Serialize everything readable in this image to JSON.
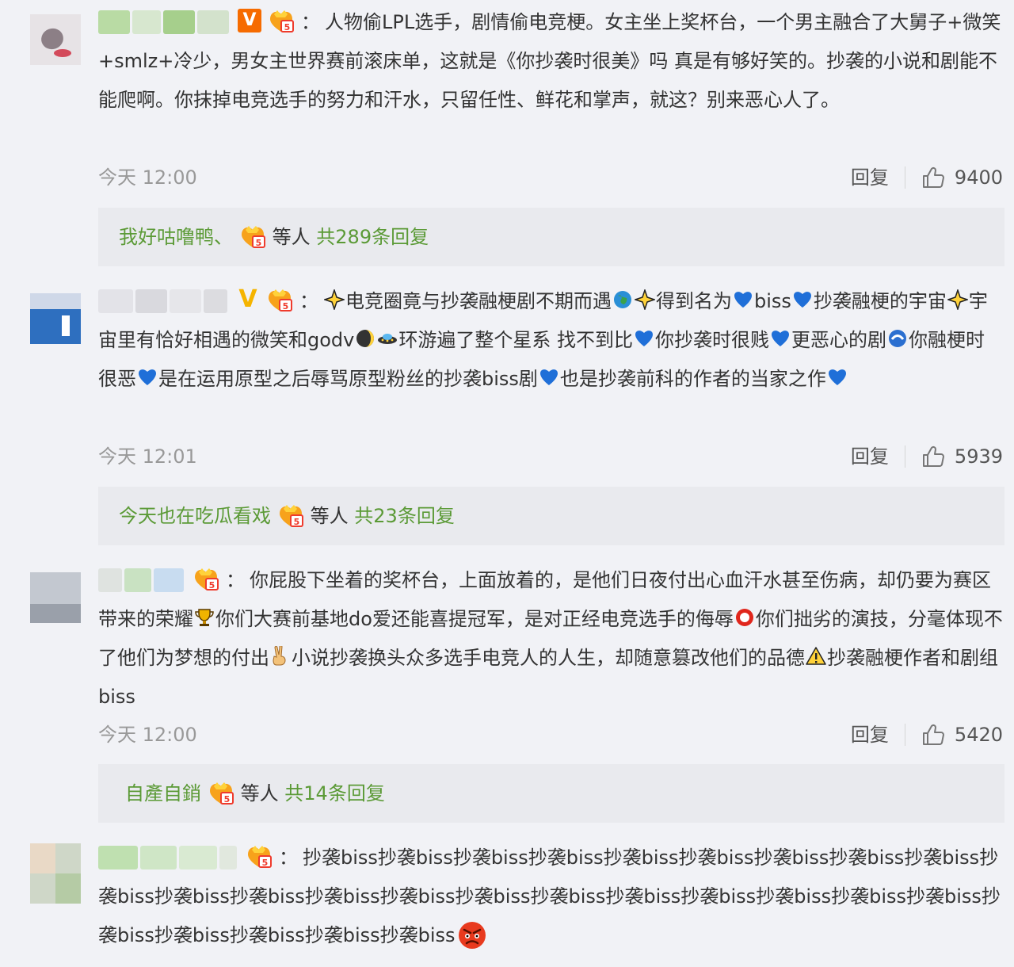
{
  "comments": [
    {
      "text": "人物偷LPL选手，剧情偷电竞梗。女主坐上奖杯台，一个男主融合了大舅子+微笑+smlz+冷少，男女主世界赛前滚床单，这就是《你抄袭时很美》吗 真是有够好笑的。抄袭的小说和剧能不能爬啊。你抹掉电竞选手的努力和汗水，只留任性、鲜花和掌声，就这？别来恶心人了。",
      "time": "今天 12:00",
      "reply_label": "回复",
      "likes": "9400",
      "replies_preview": {
        "user": "我好咕噜鸭、",
        "suffix": "等人",
        "total": "共289条回复"
      }
    },
    {
      "segments": [
        {
          "t": "电竞圈竟与抄袭融梗剧不期而遇"
        },
        {
          "t": "得到名为"
        },
        {
          "t": "biss"
        },
        {
          "t": "抄袭融梗的宇宙"
        },
        {
          "t": "宇宙里有恰好相遇的微笑和godv"
        },
        {
          "t": "环游遍了整个星系 找不到比"
        },
        {
          "t": "你抄袭时很贱"
        },
        {
          "t": "更恶心的剧"
        },
        {
          "t": "你融梗时很恶"
        },
        {
          "t": "是在运用原型之后辱骂原型粉丝的抄袭biss剧"
        },
        {
          "t": "也是抄袭前科的作者的当家之作"
        }
      ],
      "time": "今天 12:01",
      "reply_label": "回复",
      "likes": "5939",
      "replies_preview": {
        "user": "今天也在吃瓜看戏",
        "suffix": "等人",
        "total": "共23条回复"
      }
    },
    {
      "segments": [
        {
          "t": "你屁股下坐着的奖杯台，上面放着的，是他们日夜付出心血汗水甚至伤病，却仍要为赛区带来的荣耀"
        },
        {
          "t": "你们大赛前基地do爱还能喜提冠军，是对正经电竞选手的侮辱"
        },
        {
          "t": "你们拙劣的演技，分毫体现不了他们为梦想的付出"
        },
        {
          "t": "小说抄袭换头众多选手电竞人的人生，却随意篡改他们的品德"
        },
        {
          "t": "抄袭融梗作者和剧组biss"
        }
      ],
      "time": "今天 12:00",
      "reply_label": "回复",
      "likes": "5420",
      "replies_preview": {
        "user": "自產自銷",
        "suffix": "等人",
        "total": "共14条回复"
      }
    },
    {
      "text": "抄袭biss抄袭biss抄袭biss抄袭biss抄袭biss抄袭biss抄袭biss抄袭biss抄袭biss抄袭biss抄袭biss抄袭biss抄袭biss抄袭biss抄袭biss抄袭biss抄袭biss抄袭biss抄袭biss抄袭biss抄袭biss抄袭biss抄袭biss抄袭biss抄袭biss抄袭biss"
    }
  ],
  "colon": "：",
  "verified_label": "V",
  "colors": {
    "link_green": "#5b9a36",
    "reply_bg": "#e9eaee",
    "page_bg": "#f1f2f6"
  }
}
